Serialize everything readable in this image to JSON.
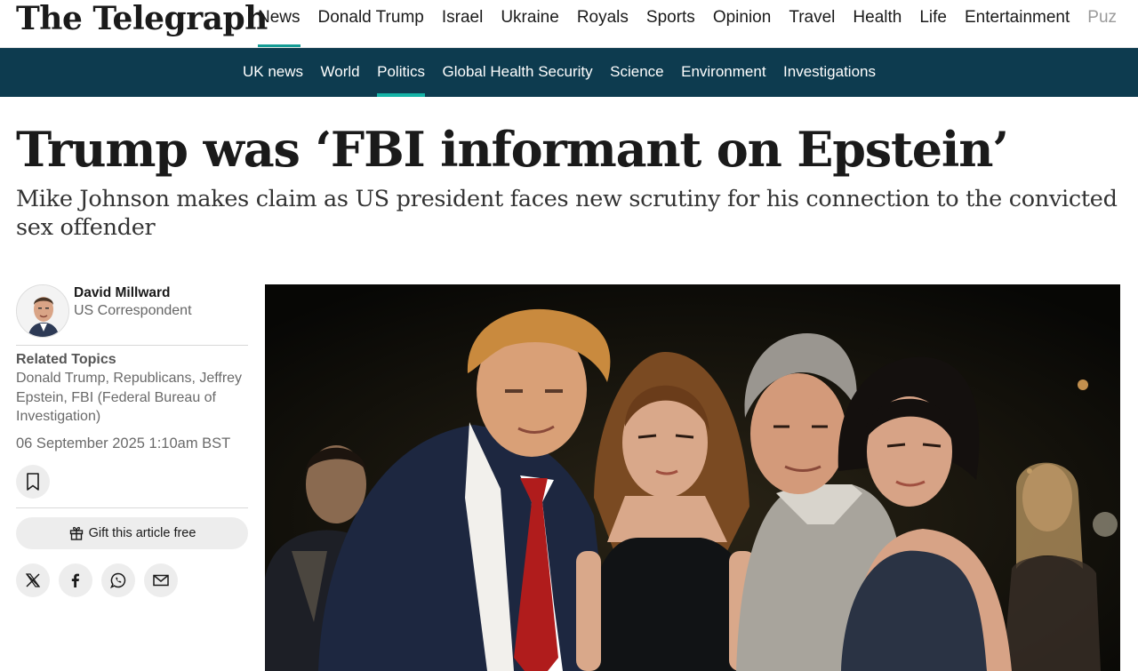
{
  "header": {
    "logo": "The Telegraph",
    "nav": [
      "News",
      "Donald Trump",
      "Israel",
      "Ukraine",
      "Royals",
      "Sports",
      "Opinion",
      "Travel",
      "Health",
      "Life",
      "Entertainment",
      "Puz"
    ],
    "active_nav": "News"
  },
  "subnav": {
    "items": [
      "UK news",
      "World",
      "Politics",
      "Global Health Security",
      "Science",
      "Environment",
      "Investigations"
    ],
    "active": "Politics"
  },
  "article": {
    "headline": "Trump was ‘FBI informant on Epstein’",
    "standfirst": "Mike Johnson makes claim as US president faces new scrutiny for his connection to the convicted sex offender"
  },
  "sidebar": {
    "author_name": "David Millward",
    "author_role": "US Correspondent",
    "related_title": "Related Topics",
    "related_topics": "Donald Trump, Republicans, Jeffrey Epstein, FBI (Federal Bureau of Investigation)",
    "date": "06 September 2025 1:10am BST",
    "gift_label": "Gift this article free"
  },
  "icons": {
    "bookmark": "bookmark-icon",
    "gift": "gift-icon",
    "x": "x-icon",
    "facebook": "facebook-icon",
    "whatsapp": "whatsapp-icon",
    "email": "email-icon"
  },
  "colors": {
    "accent": "#149c95",
    "subnav_bg": "#0d3b4f"
  }
}
